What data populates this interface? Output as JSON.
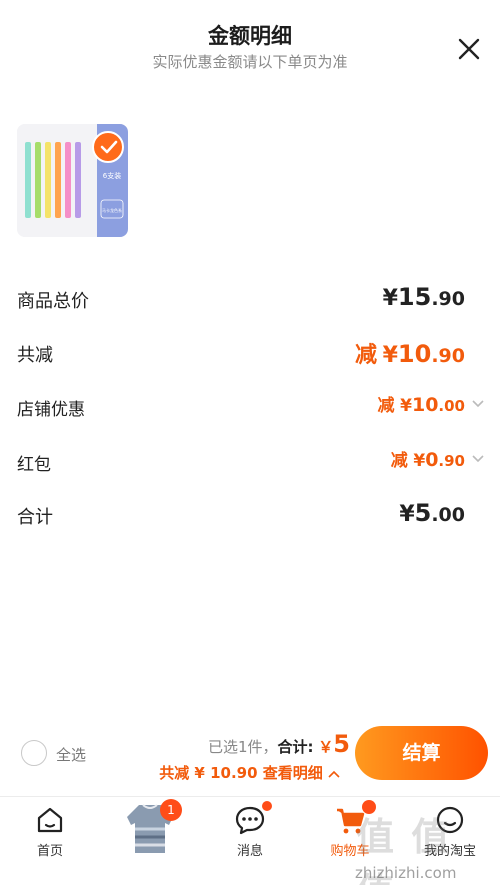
{
  "header": {
    "title": "金额明细",
    "subtitle": "实际优惠金额请以下单页为准"
  },
  "product": {
    "thumbnail_text": "6支装",
    "thumbnail_subtext": "马卡龙色系"
  },
  "rows": [
    {
      "label": "商品总价",
      "prefix": "",
      "cur": "¥",
      "int": "15",
      "dec": ".90"
    },
    {
      "label": "共减",
      "prefix": "减",
      "cur": "¥",
      "int": "10",
      "dec": ".90"
    },
    {
      "label": "店铺优惠",
      "prefix": "减",
      "cur": "¥",
      "int": "10",
      "dec": ".00"
    },
    {
      "label": "红包",
      "prefix": "减",
      "cur": "¥",
      "int": "0",
      "dec": ".90"
    },
    {
      "label": "合计",
      "prefix": "",
      "cur": "¥",
      "int": "5",
      "dec": ".00"
    }
  ],
  "bottom_bar": {
    "select_all_label": "全选",
    "selected_count": "已选1件，",
    "total_label": "合计:",
    "total_currency": "￥",
    "total_value": "5",
    "discount_text": "共减 ¥ 10.90",
    "details_link": "查看明细",
    "checkout_label": "结算"
  },
  "tabbar": {
    "home_label": "首页",
    "cart_badge": "1",
    "messages_label": "消息",
    "cart_label": "购物车",
    "profile_label": "我的淘宝"
  },
  "watermark": {
    "text": "值 值 值",
    "url": "zhizhizhi.com"
  },
  "colors": {
    "accent": "#f25b0c",
    "checkout_gradient_start": "#ff9a1f",
    "checkout_gradient_end": "#ff5200"
  }
}
